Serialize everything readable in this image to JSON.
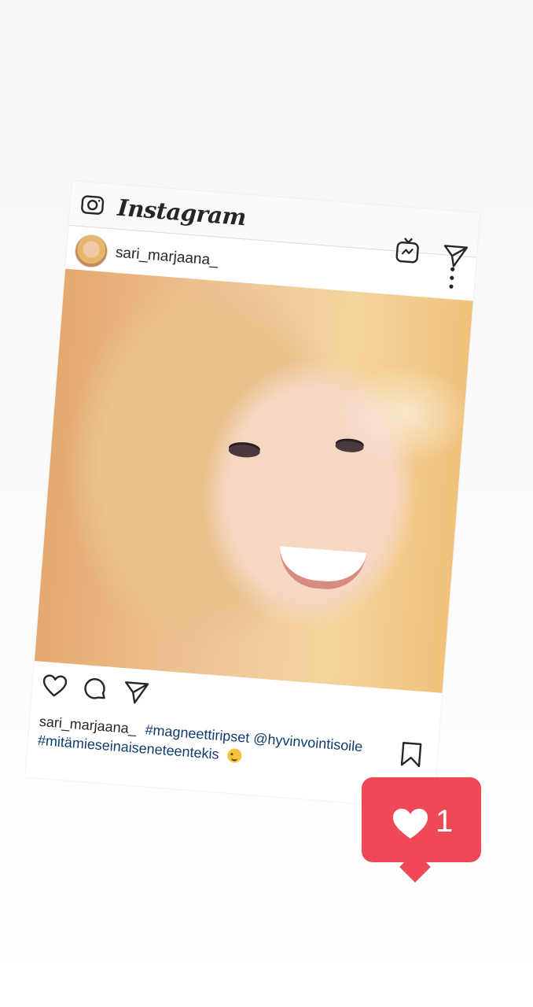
{
  "app": {
    "logo_text": "Instagram"
  },
  "post": {
    "username": "sari_marjaana_",
    "caption": {
      "username": "sari_marjaana_",
      "hashtag_1": "#magneettiripset",
      "mention": "@hyvinvointisoile",
      "hashtag_2": "#mitämieseinaiseneteentekis"
    }
  },
  "icons": {
    "camera": "camera-icon",
    "igtv": "igtv-icon",
    "send": "direct-send-icon",
    "more": "more-options-icon",
    "like": "heart-icon",
    "comment": "comment-icon",
    "share": "share-icon",
    "save": "bookmark-icon",
    "emoji": "winking-face-emoji"
  },
  "notification": {
    "like_count": "1"
  },
  "colors": {
    "notification_bg": "#ef4856",
    "link": "#0f3c6f",
    "text": "#262626"
  }
}
